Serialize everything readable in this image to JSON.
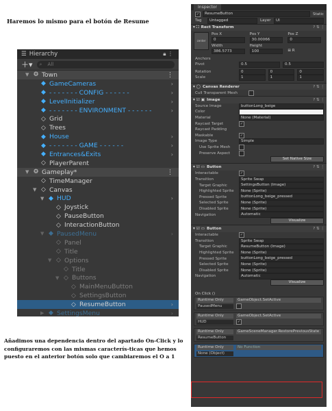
{
  "heading": "Haremos lo mismo para el botón de Resume",
  "paragraph": "Añadimos una dependencia dentro del apartado On-Click y lo configuraremos con las mismas caracterís-ticas que hemos puesto en el anterior botón solo que cambiaremos el O a 1",
  "hierarchy": {
    "title": "Hierarchy",
    "search_placeholder": "All",
    "rows": [
      {
        "label": "Town",
        "indent": 1,
        "type": "scene"
      },
      {
        "label": "GameCameras",
        "indent": 2,
        "type": "prefab"
      },
      {
        "label": "- - - - - - - CONFIG - - - - - -",
        "indent": 2,
        "type": "prefab"
      },
      {
        "label": "LevelInitializer",
        "indent": 2,
        "type": "prefab"
      },
      {
        "label": "- - - - - - - ENVIRONMENT - - - - - -",
        "indent": 2,
        "type": "prefab"
      },
      {
        "label": "Grid",
        "indent": 2,
        "type": "object"
      },
      {
        "label": "Trees",
        "indent": 2,
        "type": "object"
      },
      {
        "label": "House",
        "indent": 2,
        "type": "prefab"
      },
      {
        "label": "- - - - - - - GAME - - - - - -",
        "indent": 2,
        "type": "prefab"
      },
      {
        "label": "Entrances&Exits",
        "indent": 2,
        "type": "prefab"
      },
      {
        "label": "PlayerParent",
        "indent": 2,
        "type": "object"
      },
      {
        "label": "Gameplay*",
        "indent": 1,
        "type": "scene"
      },
      {
        "label": "TimeManager",
        "indent": 2,
        "type": "object"
      },
      {
        "label": "Canvas",
        "indent": 2,
        "type": "object"
      },
      {
        "label": "HUD",
        "indent": 3,
        "type": "prefab"
      },
      {
        "label": "Joystick",
        "indent": 4,
        "type": "object"
      },
      {
        "label": "PauseButton",
        "indent": 4,
        "type": "object"
      },
      {
        "label": "InteractionButton",
        "indent": 4,
        "type": "object"
      },
      {
        "label": "PausedMenu",
        "indent": 3,
        "type": "prefab-faded"
      },
      {
        "label": "Panel",
        "indent": 4,
        "type": "faded"
      },
      {
        "label": "Title",
        "indent": 4,
        "type": "faded"
      },
      {
        "label": "Options",
        "indent": 4,
        "type": "faded"
      },
      {
        "label": "Title",
        "indent": 5,
        "type": "faded"
      },
      {
        "label": "Buttons",
        "indent": 5,
        "type": "faded"
      },
      {
        "label": "MainMenuButton",
        "indent": 6,
        "type": "faded"
      },
      {
        "label": "SettingsButton",
        "indent": 6,
        "type": "faded"
      },
      {
        "label": "ResumeButton",
        "indent": 6,
        "type": "selected"
      },
      {
        "label": "SettingsMenu",
        "indent": 3,
        "type": "prefab-faded"
      }
    ]
  },
  "inspector": {
    "tab": "Inspector",
    "object_name": "ResumeButton",
    "static": "Static",
    "tag": "Untagged",
    "layer": "UI",
    "rect_transform": {
      "title": "Rect Transform",
      "anchor": "center",
      "pos_x": "0",
      "pos_y": "30.00066",
      "pos_z": "0",
      "width": "386.5773",
      "height": "100",
      "pivot_x": "0.5",
      "pivot_y": "0.5",
      "rotation": [
        "0",
        "0",
        "0"
      ],
      "scale": [
        "1",
        "1",
        "1"
      ]
    },
    "canvas_renderer": {
      "title": "Canvas Renderer",
      "cull": "Cull Transparent Mesh"
    },
    "image": {
      "title": "Image",
      "source_image": "buttonLong_beige",
      "material": "None (Material)",
      "image_type": "Simple",
      "button": "Set Native Size"
    },
    "button1": {
      "title": "Button",
      "transition": "Sprite Swap",
      "target_graphic": "SettingsButton (Image)",
      "highlighted": "None (Sprite)",
      "pressed": "buttonLong_beige_pressed",
      "selected": "None (Sprite)",
      "disabled": "None (Sprite)",
      "navigation": "Automatic",
      "visualize": "Visualize"
    },
    "button2": {
      "title": "Button",
      "transition": "Sprite Swap",
      "target_graphic": "ResumeButton (Image)",
      "highlighted": "None (Sprite)",
      "pressed": "buttonLong_beige_pressed",
      "selected": "None (Sprite)",
      "disabled": "None (Sprite)",
      "navigation": "Automatic",
      "visualize": "Visualize"
    },
    "onclick": {
      "title": "On Click ()",
      "events": [
        {
          "mode": "Runtime Only",
          "func": "GameObject.SetActive",
          "obj": "PausedMenu"
        },
        {
          "mode": "Runtime Only",
          "func": "GameObject.SetActive",
          "obj": "HUD"
        },
        {
          "mode": "Runtime Only",
          "func": "GameSceneManager.RestorePreviousState",
          "obj": "ResumeButton"
        },
        {
          "mode": "Runtime Only",
          "func": "No Function",
          "obj": "None (Object)"
        }
      ]
    },
    "labels": {
      "tag": "Tag",
      "layer": "Layer",
      "posx": "Pos X",
      "posy": "Pos Y",
      "posz": "Pos Z",
      "width": "Width",
      "height": "Height",
      "anchors": "Anchors",
      "pivot": "Pivot",
      "rotation": "Rotation",
      "scale": "Scale",
      "source": "Source Image",
      "color": "Color",
      "material": "Material",
      "raycast": "Raycast Target",
      "raypad": "Raycast Padding",
      "maskable": "Maskable",
      "imgtype": "Image Type",
      "usesprite": "Use Sprite Mesh",
      "preserve": "Preserve Aspect",
      "interactable": "Interactable",
      "transition": "Transition",
      "target": "Target Graphic",
      "highlighted": "Highlighted Sprite",
      "pressed": "Pressed Sprite",
      "selected": "Selected Sprite",
      "disabled": "Disabled Sprite",
      "navigation": "Navigation"
    }
  }
}
